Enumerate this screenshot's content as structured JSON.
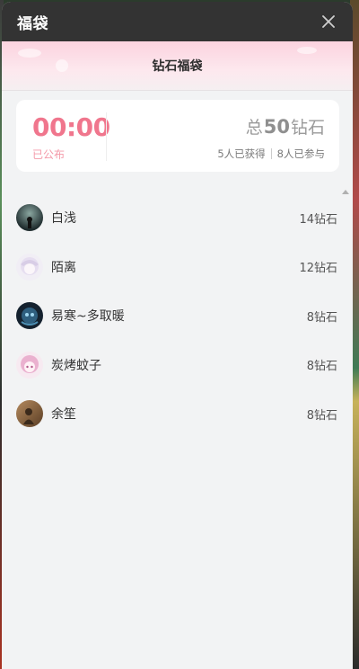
{
  "dialog": {
    "title": "福袋",
    "close_icon": "close-icon"
  },
  "header": {
    "title": "钻石福袋"
  },
  "summary": {
    "timer": "00:00",
    "timer_label": "已公布",
    "total_prefix": "总",
    "total_amount": "50",
    "total_unit": "钻石",
    "winners_text": "5人已获得",
    "participants_text": "8人已参与"
  },
  "winners": [
    {
      "name": "白浅",
      "amount": "14钻石",
      "avatar": "avatar-dark-figure"
    },
    {
      "name": "陌离",
      "amount": "12钻石",
      "avatar": "avatar-white-hair"
    },
    {
      "name": "易寒~多取暖",
      "amount": "8钻石",
      "avatar": "avatar-blue-night"
    },
    {
      "name": "炭烤蚊子",
      "amount": "8钻石",
      "avatar": "avatar-pink-hair"
    },
    {
      "name": "余笙",
      "amount": "8钻石",
      "avatar": "avatar-brown-sepia"
    }
  ],
  "colors": {
    "accent": "#f0768d",
    "topbar": "#333333",
    "panel_bg": "#f2f3f4"
  }
}
